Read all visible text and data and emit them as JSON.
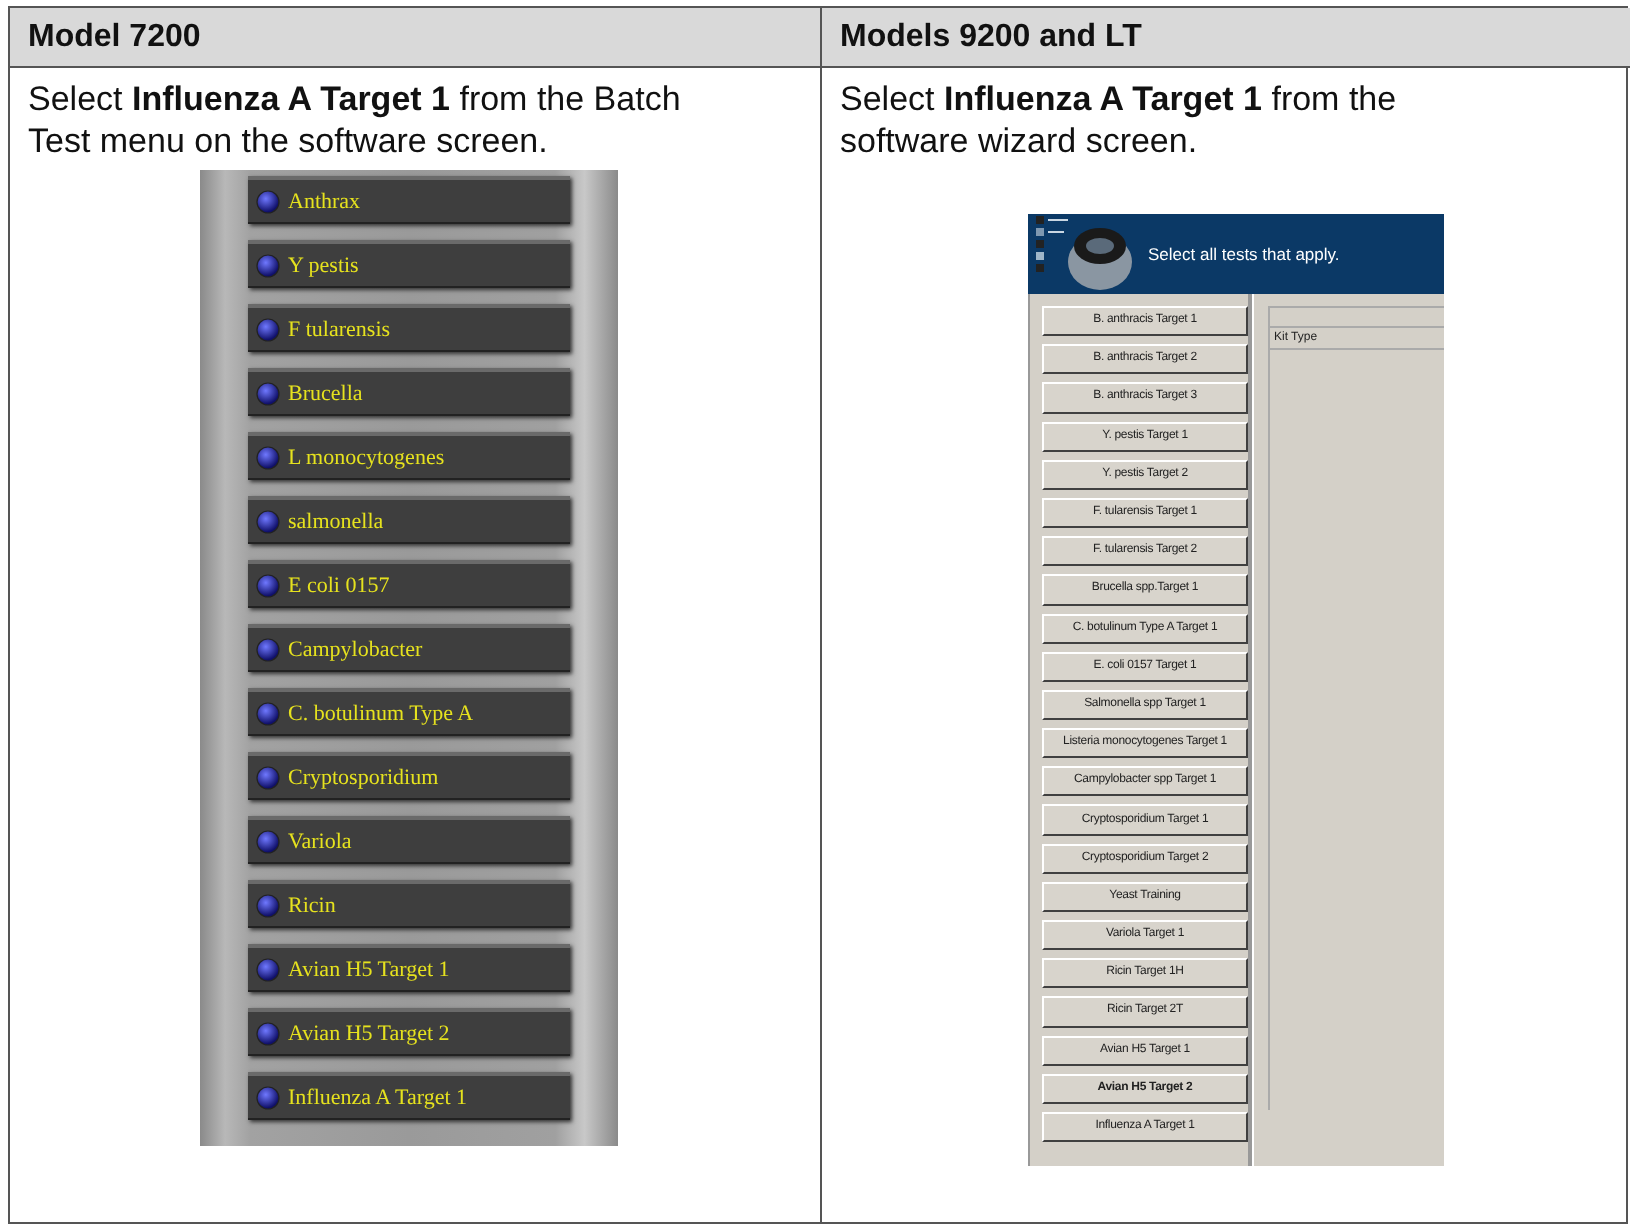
{
  "columns": [
    {
      "heading": "Model 7200",
      "instruction": "Select **Influenza A Target 1** from the Batch Test menu on the software screen.",
      "screen": {
        "kind": "menu",
        "items": [
          {
            "label": "Anthrax"
          },
          {
            "label": "Y pestis"
          },
          {
            "label": "F tularensis"
          },
          {
            "label": "Brucella"
          },
          {
            "label": "L monocytogenes"
          },
          {
            "label": "salmonella"
          },
          {
            "label": "E coli 0157"
          },
          {
            "label": "Campylobacter"
          },
          {
            "label": "C. botulinum Type A"
          },
          {
            "label": "Cryptosporidium"
          },
          {
            "label": "Variola"
          },
          {
            "label": "Ricin"
          },
          {
            "label": "Avian H5 Target 1"
          },
          {
            "label": "Avian H5 Target 2"
          },
          {
            "label": "Influenza A Target 1"
          }
        ]
      }
    },
    {
      "heading": "Models 9200 and LT",
      "instruction": "Select **Influenza A Target 1** from the software wizard screen.",
      "screen": {
        "kind": "wizard",
        "banner": "Select all tests that apply.",
        "list_header": "Kit Type",
        "tests": [
          {
            "label": "B. anthracis Target 1",
            "selected": false
          },
          {
            "label": "B. anthracis Target 2",
            "selected": false
          },
          {
            "label": "B. anthracis Target 3",
            "selected": false
          },
          {
            "label": "Y. pestis Target 1",
            "selected": false
          },
          {
            "label": "Y. pestis Target 2",
            "selected": false
          },
          {
            "label": "F. tularensis Target 1",
            "selected": false
          },
          {
            "label": "F. tularensis Target 2",
            "selected": false
          },
          {
            "label": "Brucella spp.Target 1",
            "selected": false
          },
          {
            "label": "C. botulinum Type A Target 1",
            "selected": false
          },
          {
            "label": "E. coli 0157 Target 1",
            "selected": false
          },
          {
            "label": "Salmonella spp Target 1",
            "selected": false
          },
          {
            "label": "Listeria monocytogenes Target 1",
            "selected": false
          },
          {
            "label": "Campylobacter spp Target 1",
            "selected": false
          },
          {
            "label": "Cryptosporidium Target 1",
            "selected": false
          },
          {
            "label": "Cryptosporidium Target 2",
            "selected": false
          },
          {
            "label": "Yeast Training",
            "selected": false
          },
          {
            "label": "Variola Target 1",
            "selected": false
          },
          {
            "label": "Ricin Target 1H",
            "selected": false
          },
          {
            "label": "Ricin Target 2T",
            "selected": false
          },
          {
            "label": "Avian H5 Target 1",
            "selected": false
          },
          {
            "label": "Avian H5 Target 2",
            "selected": true
          },
          {
            "label": "Influenza A Target 1",
            "selected": false
          }
        ]
      }
    }
  ]
}
